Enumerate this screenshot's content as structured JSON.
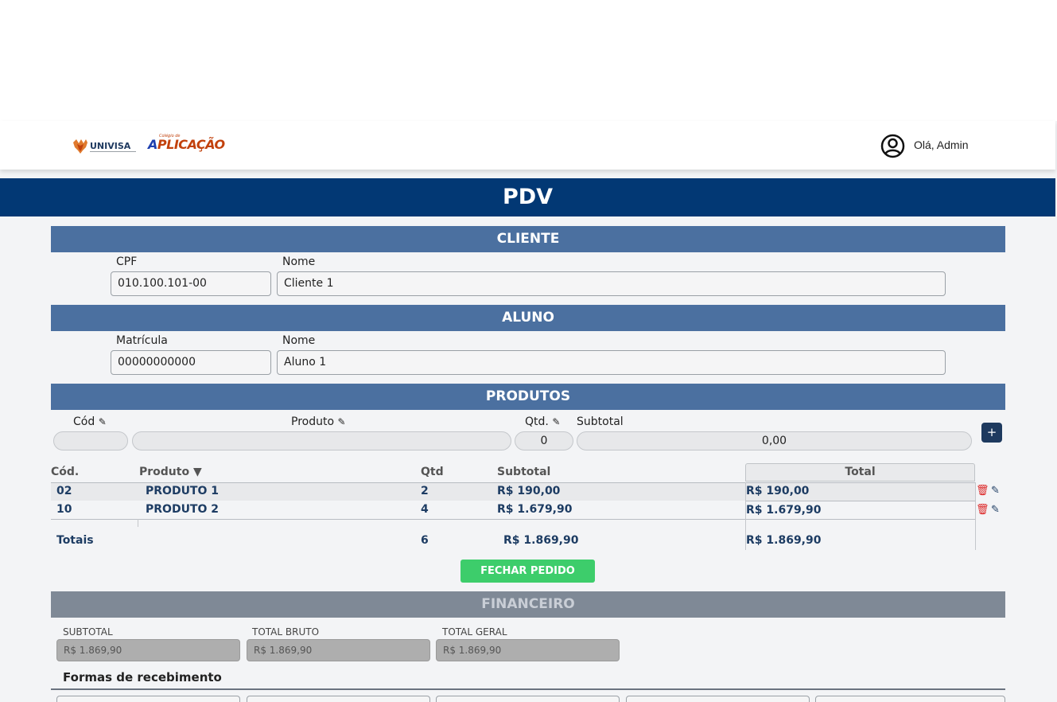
{
  "header": {
    "logo1_text": "UNIVISA",
    "logo2_small": "Colégio de",
    "logo2_text_a": "A",
    "logo2_text_b": "PLICAÇÃO",
    "greeting": "Olá, Admin"
  },
  "title": "PDV",
  "cliente": {
    "section": "CLIENTE",
    "cpf_label": "CPF",
    "cpf_value": "010.100.101-00",
    "nome_label": "Nome",
    "nome_value": "Cliente 1"
  },
  "aluno": {
    "section": "ALUNO",
    "matricula_label": "Matrícula",
    "matricula_value": "00000000000",
    "nome_label": "Nome",
    "nome_value": "Aluno 1"
  },
  "produtos": {
    "section": "PRODUTOS",
    "cod_label": "Cód",
    "produto_label": "Produto",
    "qtd_label": "Qtd.",
    "subtotal_label": "Subtotal",
    "qtd_value": "0",
    "subtotal_value": "0,00",
    "add_label": "+",
    "table": {
      "headers": {
        "cod": "Cód.",
        "produto": "Produto ▼",
        "qtd": "Qtd",
        "subtotal": "Subtotal",
        "total": "Total"
      },
      "rows": [
        {
          "cod": "02",
          "produto": "PRODUTO 1",
          "qtd": "2",
          "subtotal": "R$ 190,00",
          "total": "R$ 190,00"
        },
        {
          "cod": "10",
          "produto": "PRODUTO 2",
          "qtd": "4",
          "subtotal": "R$ 1.679,90",
          "total": "R$ 1.679,90"
        }
      ],
      "totals": {
        "label": "Totais",
        "qtd": "6",
        "subtotal": "R$ 1.869,90",
        "total": "R$ 1.869,90"
      }
    },
    "fechar_label": "FECHAR PEDIDO"
  },
  "financeiro": {
    "section": "FINANCEIRO",
    "subtotal_label": "SUBTOTAL",
    "subtotal_value": "R$ 1.869,90",
    "bruto_label": "TOTAL BRUTO",
    "bruto_value": "R$ 1.869,90",
    "geral_label": "TOTAL GERAL",
    "geral_value": "R$ 1.869,90",
    "formas_label": "Formas de recebimento"
  },
  "colors": {
    "pdv_bar": "#023874",
    "section_bar": "#4b70a0",
    "financeiro_bar": "#7f8996",
    "fechar_button": "#3dcd6b",
    "trash": "#dc2626"
  }
}
